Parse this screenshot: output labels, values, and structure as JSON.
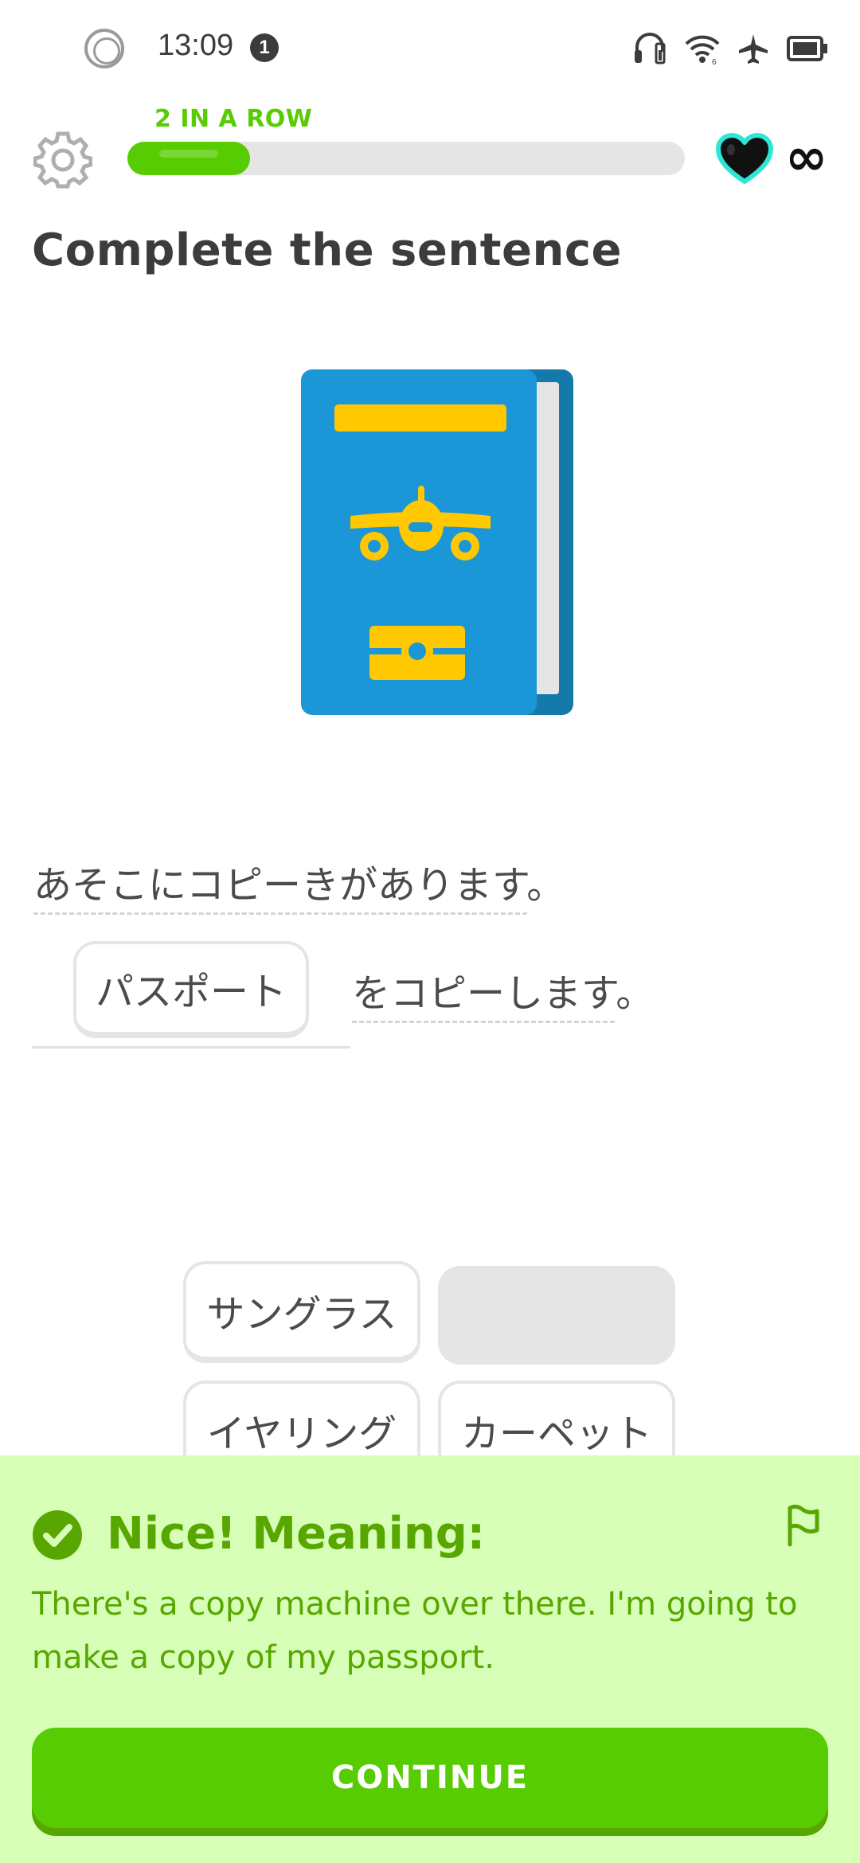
{
  "status_bar": {
    "time": "13:09",
    "notification_count": "1",
    "icons": [
      "circle-ring-icon",
      "headset-icon",
      "wifi-icon",
      "airplane-mode-icon",
      "battery-icon"
    ]
  },
  "header": {
    "streak_label": "2 IN A ROW",
    "progress_fraction": 0.22,
    "hearts_count": "∞",
    "icons": [
      "gear-icon",
      "heart-icon"
    ]
  },
  "exercise": {
    "title": "Complete the sentence",
    "illustration": "passport-illustration",
    "sentence_line1": "あそこにコピーきがあります。",
    "selected_answer": "パスポート",
    "sentence_line2_suffix": "をコピーします。"
  },
  "word_bank": {
    "words": [
      "サングラス",
      "",
      "イヤリング",
      "カーペット"
    ]
  },
  "feedback": {
    "title": "Nice! Meaning:",
    "translation": "There's a copy machine over there. I'm going to make a copy of my passport.",
    "continue_label": "CONTINUE",
    "icons": [
      "check-circle-icon",
      "flag-icon"
    ]
  },
  "colors": {
    "accent_green": "#58cc02",
    "feedback_bg": "#d7ffb8",
    "feedback_text": "#58a700",
    "passport_blue": "#1b96d6",
    "passport_gold": "#ffc800",
    "heart_cyan": "#2ee6d6"
  }
}
